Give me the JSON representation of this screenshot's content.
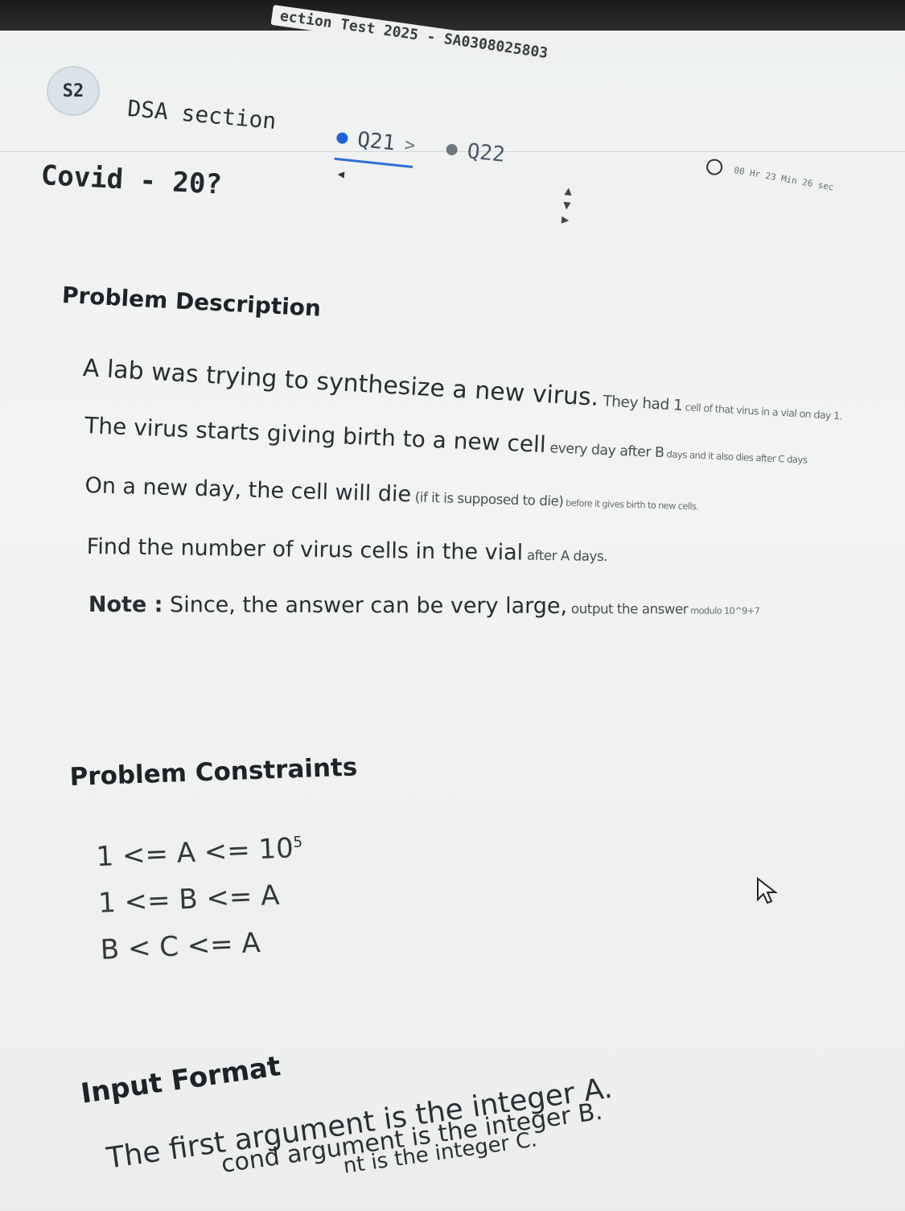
{
  "window": {
    "test_title": "ection Test 2025 - SA0308025803"
  },
  "header": {
    "section_badge": "S2",
    "section_name": "DSA section",
    "tabs": [
      {
        "label": "Q21",
        "status_color": "#1f5fd8",
        "active": true
      },
      {
        "label": "Q22",
        "status_color": "#6f7780",
        "active": false
      }
    ],
    "timer_text": "00 Hr 23 Min 26 sec"
  },
  "question": {
    "title": "Covid - 20?",
    "description": {
      "heading": "Problem Description",
      "line1": {
        "main": "A lab was trying to synthesize a new virus.",
        "mid": " They had 1",
        "tail": " cell of that virus in a vial on day 1."
      },
      "line2": {
        "main": "The virus starts giving birth to a new cell",
        "mid": " every day after B",
        "tail": " days and it also dies after C days"
      },
      "line3": {
        "main": "On a new day, the cell will die",
        "mid": " (if it is supposed to die)",
        "tail": " before it gives birth to new cells."
      },
      "line4": {
        "main": "Find the number of virus cells in the vial",
        "mid": " after A days.",
        "tail": ""
      },
      "note": {
        "label": "Note :",
        "main": " Since, the answer can be very large,",
        "mid": " output the answer",
        "tail": " modulo 10^9+7"
      }
    },
    "constraints": {
      "heading": "Problem Constraints",
      "c1": {
        "text": "1 <= A <= 10",
        "exp": "5"
      },
      "c2": "1 <= B <= A",
      "c3": "B < C <= A"
    },
    "input_format": {
      "heading": "Input Format",
      "line1": "The first argument is the integer A.",
      "line2": "cond argument is the integer B.",
      "line3": "nt is the integer C."
    }
  },
  "colors": {
    "accent": "#2f6fd6",
    "topbar": "#1a1b1d"
  }
}
